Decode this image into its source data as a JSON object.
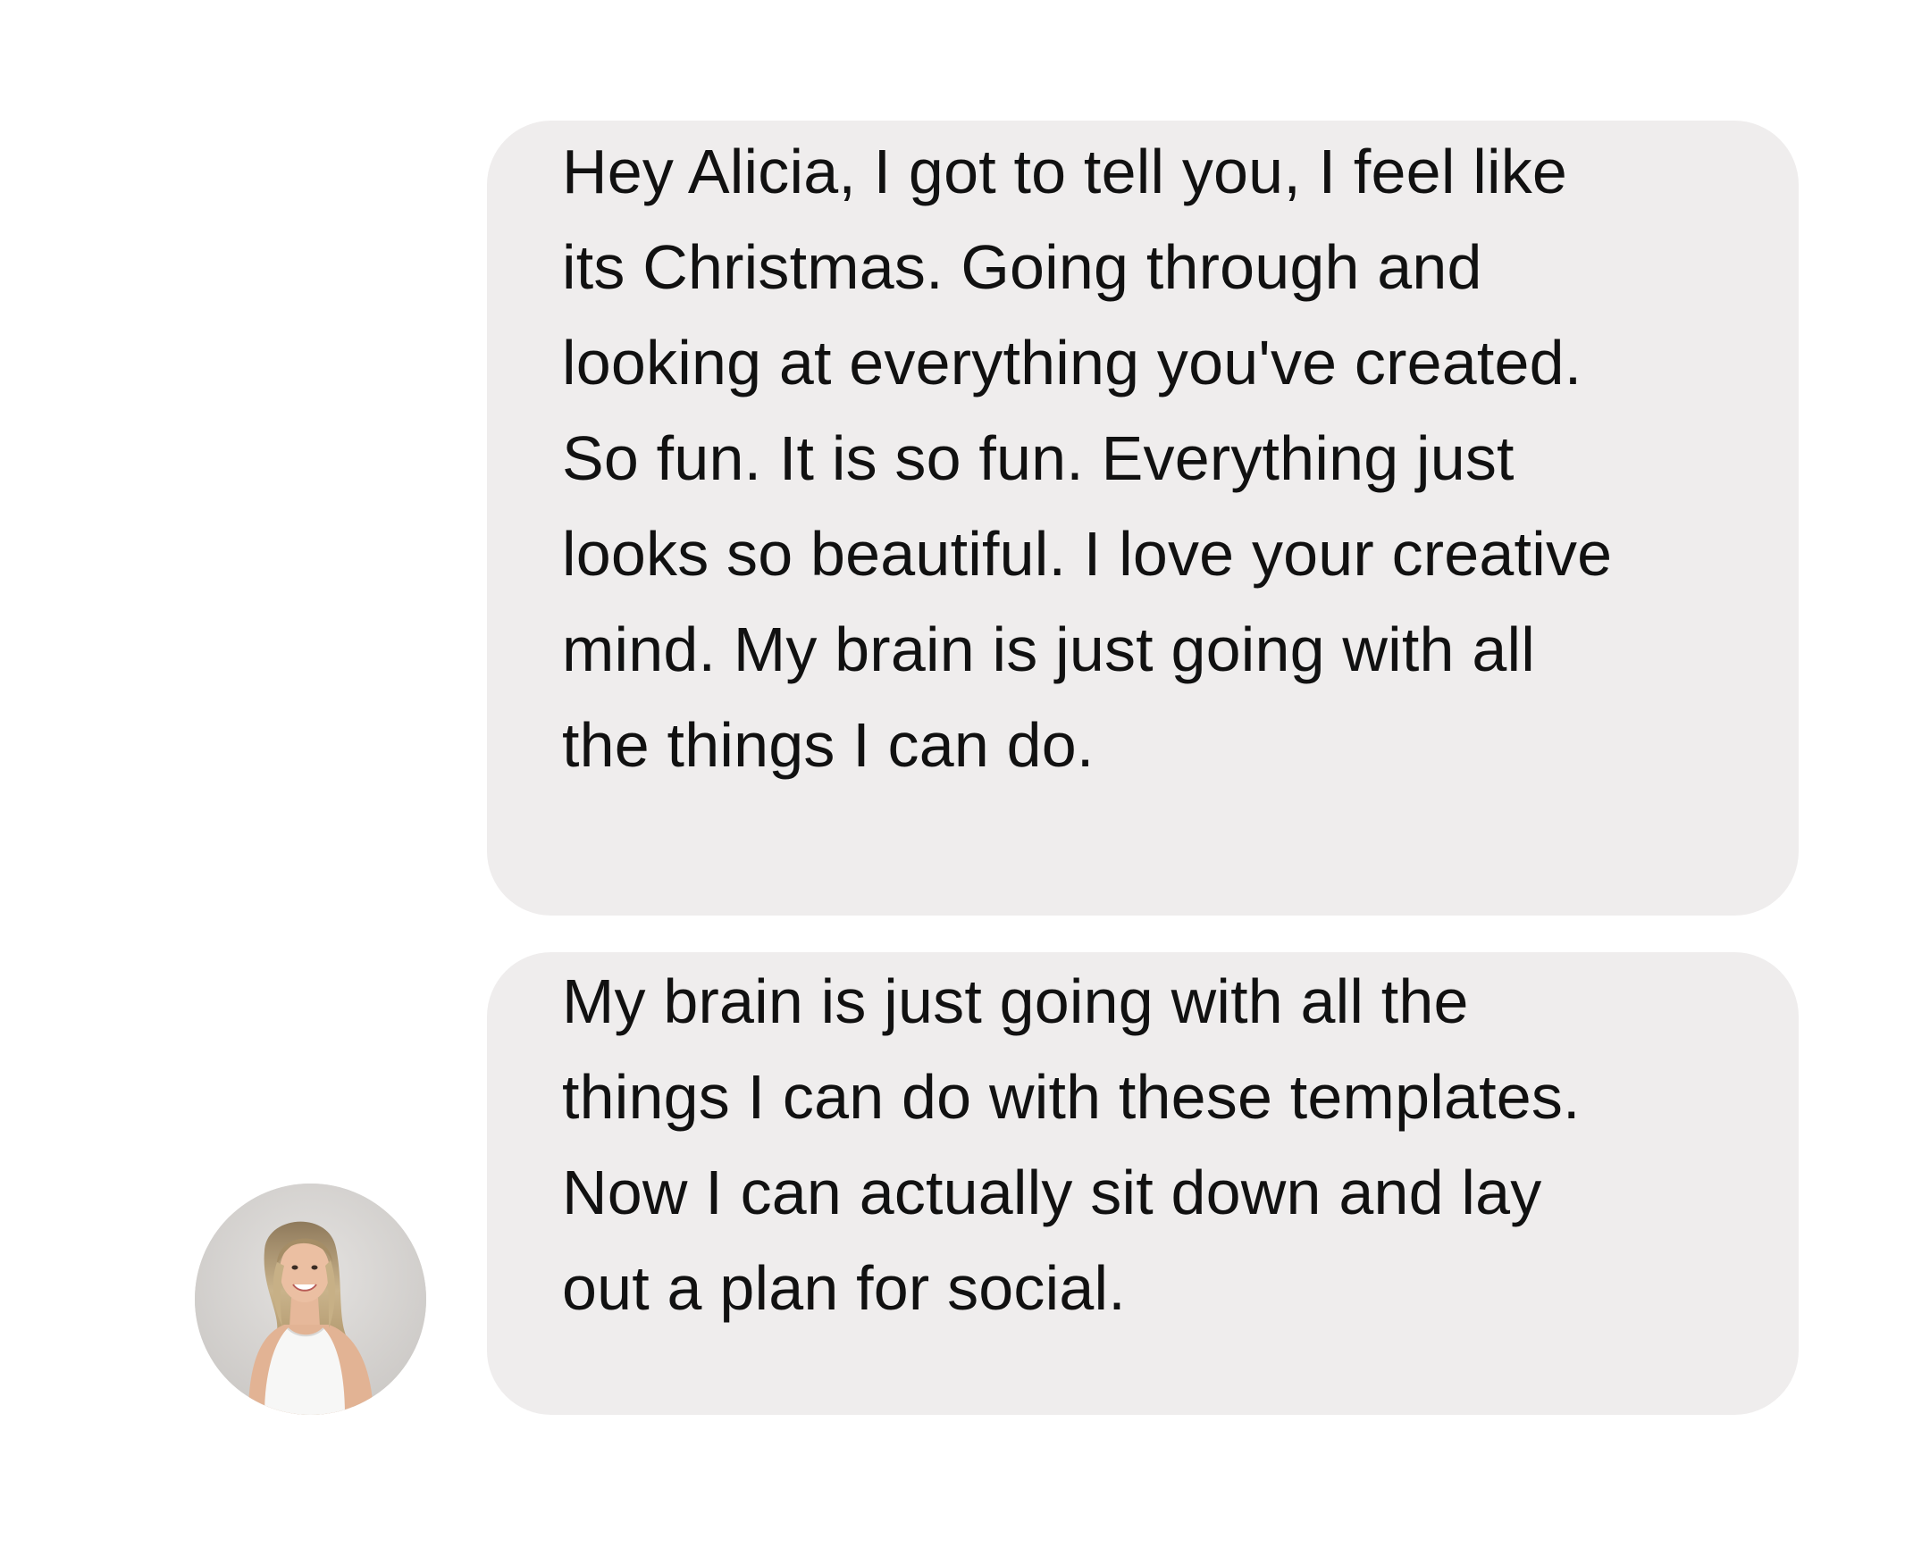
{
  "conversation": {
    "messages": [
      {
        "lines": [
          "Hey Alicia, I got to tell you, I feel like",
          "its Christmas. Going through and",
          "looking at everything you've created.",
          "So fun. It is so fun. Everything just",
          "looks so beautiful. I love your creative",
          "mind. My brain is just going with all",
          "the things I can do."
        ]
      },
      {
        "lines": [
          "My brain is just going with all the",
          "things I can do with these templates.",
          "Now I can actually sit down and lay",
          "out a plan for social."
        ]
      }
    ]
  },
  "colors": {
    "bubble_background": "#efeded",
    "text": "#111111",
    "page_background": "#ffffff"
  },
  "icons": {
    "sender_avatar": "avatar-photo"
  }
}
